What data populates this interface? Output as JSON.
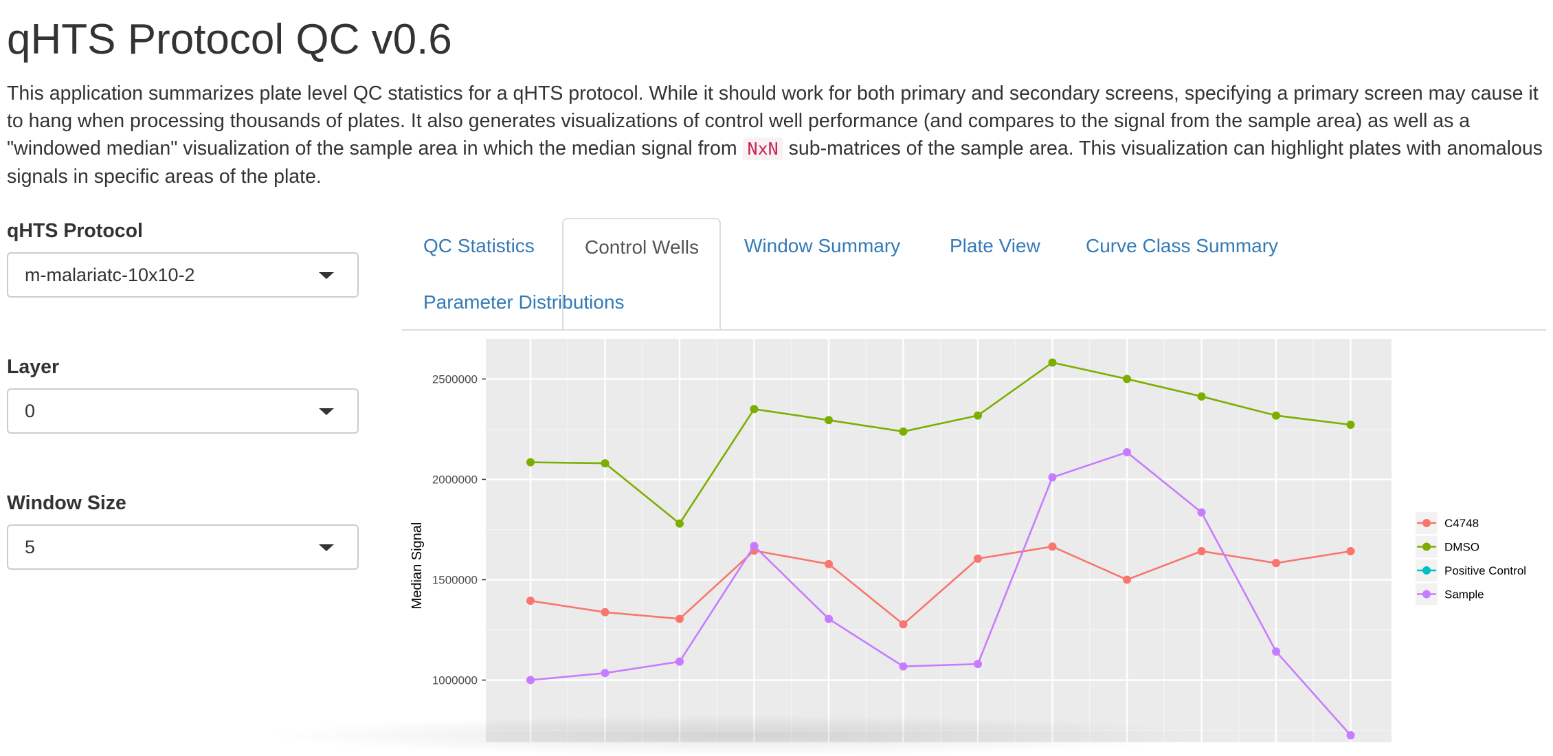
{
  "header": {
    "title": "qHTS Protocol QC v0.6",
    "intro_before_code": "This application summarizes plate level QC statistics for a qHTS protocol. While it should work for both primary and secondary screens, specifying a primary screen may cause it to hang when processing thousands of plates. It also generates visualizations of control well performance (and compares to the signal from the sample area) as well as a \"windowed median\" visualization of the sample area in which the median signal from ",
    "intro_code": "NxN",
    "intro_after_code": " sub-matrices of the sample area. This visualization can highlight plates with anomalous signals in specific areas of the plate."
  },
  "sidebar": {
    "protocol": {
      "label": "qHTS Protocol",
      "value": "m-malariatc-10x10-2"
    },
    "layer": {
      "label": "Layer",
      "value": "0"
    },
    "window_size": {
      "label": "Window Size",
      "value": "5"
    }
  },
  "tabs": [
    {
      "label": "QC Statistics",
      "active": false
    },
    {
      "label": "Control Wells",
      "active": true
    },
    {
      "label": "Window Summary",
      "active": false
    },
    {
      "label": "Plate View",
      "active": false
    },
    {
      "label": "Curve Class Summary",
      "active": false
    },
    {
      "label": "Parameter Distributions",
      "active": false
    }
  ],
  "colors": {
    "link": "#337ab7",
    "panel_bg": "#ebebeb",
    "C4748": "#f8766d",
    "DMSO": "#7cae00",
    "Positive Control": "#00bfc4",
    "Sample": "#c77cff"
  },
  "chart_data": {
    "type": "line",
    "ylabel": "Median Signal",
    "xlabel": "",
    "ylim": [
      680000,
      2700000
    ],
    "yticks": [
      1000000,
      1500000,
      2000000,
      2500000
    ],
    "ytick_labels": [
      "1000000",
      "1500000",
      "2000000",
      "2500000"
    ],
    "x": [
      1,
      2,
      3,
      4,
      5,
      6,
      7,
      8,
      9,
      10,
      11,
      12
    ],
    "legend_position": "right",
    "grid": true,
    "series": [
      {
        "name": "C4748",
        "values": [
          1395000,
          1338000,
          1305000,
          1645000,
          1578000,
          1278000,
          1605000,
          1665000,
          1500000,
          1642000,
          1583000,
          1642000
        ]
      },
      {
        "name": "DMSO",
        "values": [
          2085000,
          2080000,
          1780000,
          2350000,
          2295000,
          2238000,
          2318000,
          2582000,
          2500000,
          2413000,
          2318000,
          2272000
        ]
      },
      {
        "name": "Positive Control",
        "values": []
      },
      {
        "name": "Sample",
        "values": [
          1000000,
          1035000,
          1092000,
          1668000,
          1305000,
          1068000,
          1080000,
          2010000,
          2135000,
          1835000,
          1142000,
          725000
        ]
      }
    ]
  }
}
